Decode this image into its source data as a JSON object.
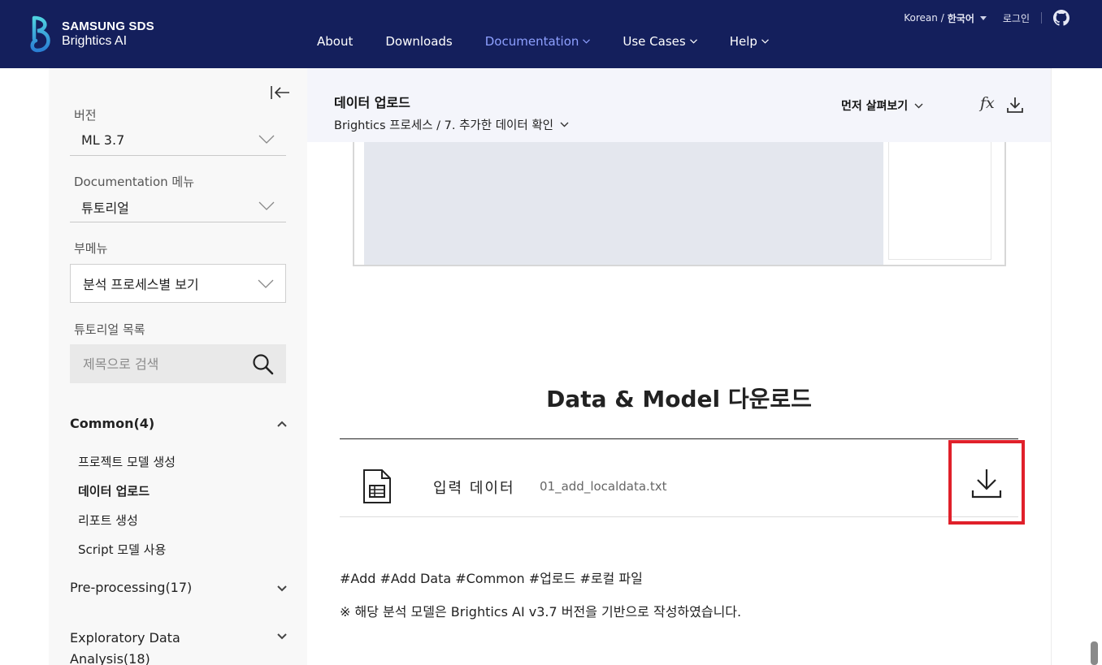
{
  "brand": {
    "line1": "SAMSUNG SDS",
    "line2": "Brightics AI"
  },
  "nav": {
    "items": [
      {
        "label": "About"
      },
      {
        "label": "Downloads"
      },
      {
        "label": "Documentation"
      },
      {
        "label": "Use Cases"
      },
      {
        "label": "Help"
      }
    ],
    "active": "Documentation",
    "language_prefix": "Korean /",
    "language_value": "한국어",
    "login": "로그인"
  },
  "sidebar": {
    "version_label": "버전",
    "version_value": "ML 3.7",
    "docmenu_label": "Documentation 메뉴",
    "docmenu_value": "튜토리얼",
    "submenu_label": "부메뉴",
    "submenu_value": "분석 프로세스별 보기",
    "list_label": "튜토리얼 목록",
    "search_placeholder": "제목으로 검색",
    "categories": [
      {
        "label": "Common(4)"
      },
      {
        "label": "Pre-processing(17)"
      },
      {
        "label": "Exploratory Data Analysis(18)"
      }
    ],
    "common_items": [
      {
        "label": "프로젝트 모델 생성"
      },
      {
        "label": "데이터 업로드"
      },
      {
        "label": "리포트 생성"
      },
      {
        "label": "Script 모델 사용"
      }
    ]
  },
  "content": {
    "title": "데이터 업로드",
    "breadcrumb": "Brightics 프로세스 / 7. 추가한 데이터 확인",
    "preview": "먼저 살펴보기",
    "fx_label": "fx",
    "download_section_title": "Data & Model 다운로드",
    "download_row": {
      "label": "입력 데이터",
      "file": "01_add_localdata.txt"
    },
    "tags": "#Add #Add Data #Common #업로드 #로컬 파일",
    "note": "※ 해당 분석 모델은 Brightics AI v3.7 버전을 기반으로 작성하였습니다."
  },
  "colors": {
    "nav_bg": "#141f5c",
    "nav_active": "#8ea0ff",
    "highlight_box": "#e0202a"
  }
}
